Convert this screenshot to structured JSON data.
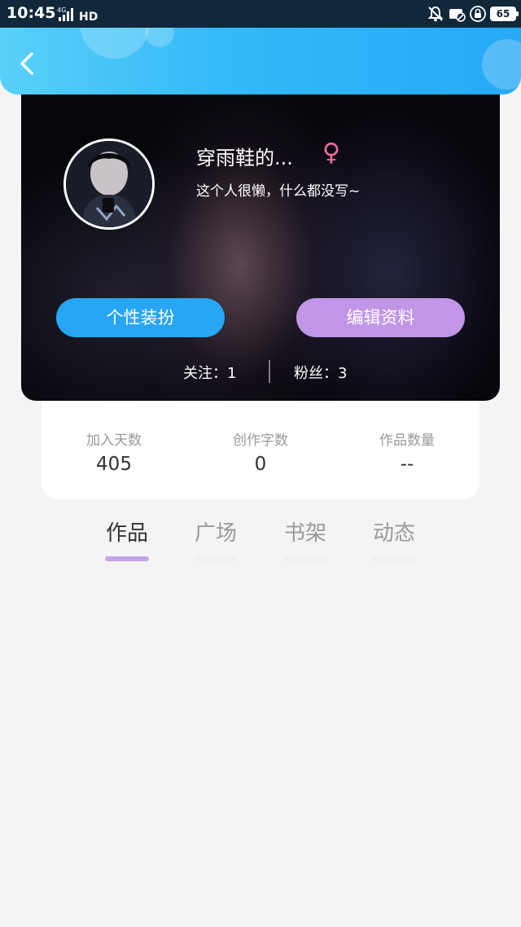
{
  "status_bar": {
    "time": "10:45",
    "signal_label": "4G",
    "hd_label": "HD",
    "battery": "65"
  },
  "header": {
    "back_icon": "chevron-left-icon"
  },
  "profile": {
    "nickname": "穿雨鞋的...",
    "gender_symbol": "♀",
    "bio": "这个人很懒，什么都没写~",
    "buttons": {
      "dress_up": "个性装扮",
      "edit_profile": "编辑资料"
    },
    "following": "关注：1",
    "followers": "粉丝：3"
  },
  "stats": [
    {
      "label": "加入天数",
      "value": "405"
    },
    {
      "label": "创作字数",
      "value": "0"
    },
    {
      "label": "作品数量",
      "value": "--"
    }
  ],
  "tabs": [
    {
      "label": "作品",
      "active": true
    },
    {
      "label": "广场",
      "active": false
    },
    {
      "label": "书架",
      "active": false
    },
    {
      "label": "动态",
      "active": false
    }
  ],
  "colors": {
    "header_blue": "#27a9f7",
    "dress_up_button": "#27a6f4",
    "edit_button": "#c196e6",
    "gender_pink": "#ef6f9a",
    "active_tab_underline": "#c7a4e8"
  }
}
